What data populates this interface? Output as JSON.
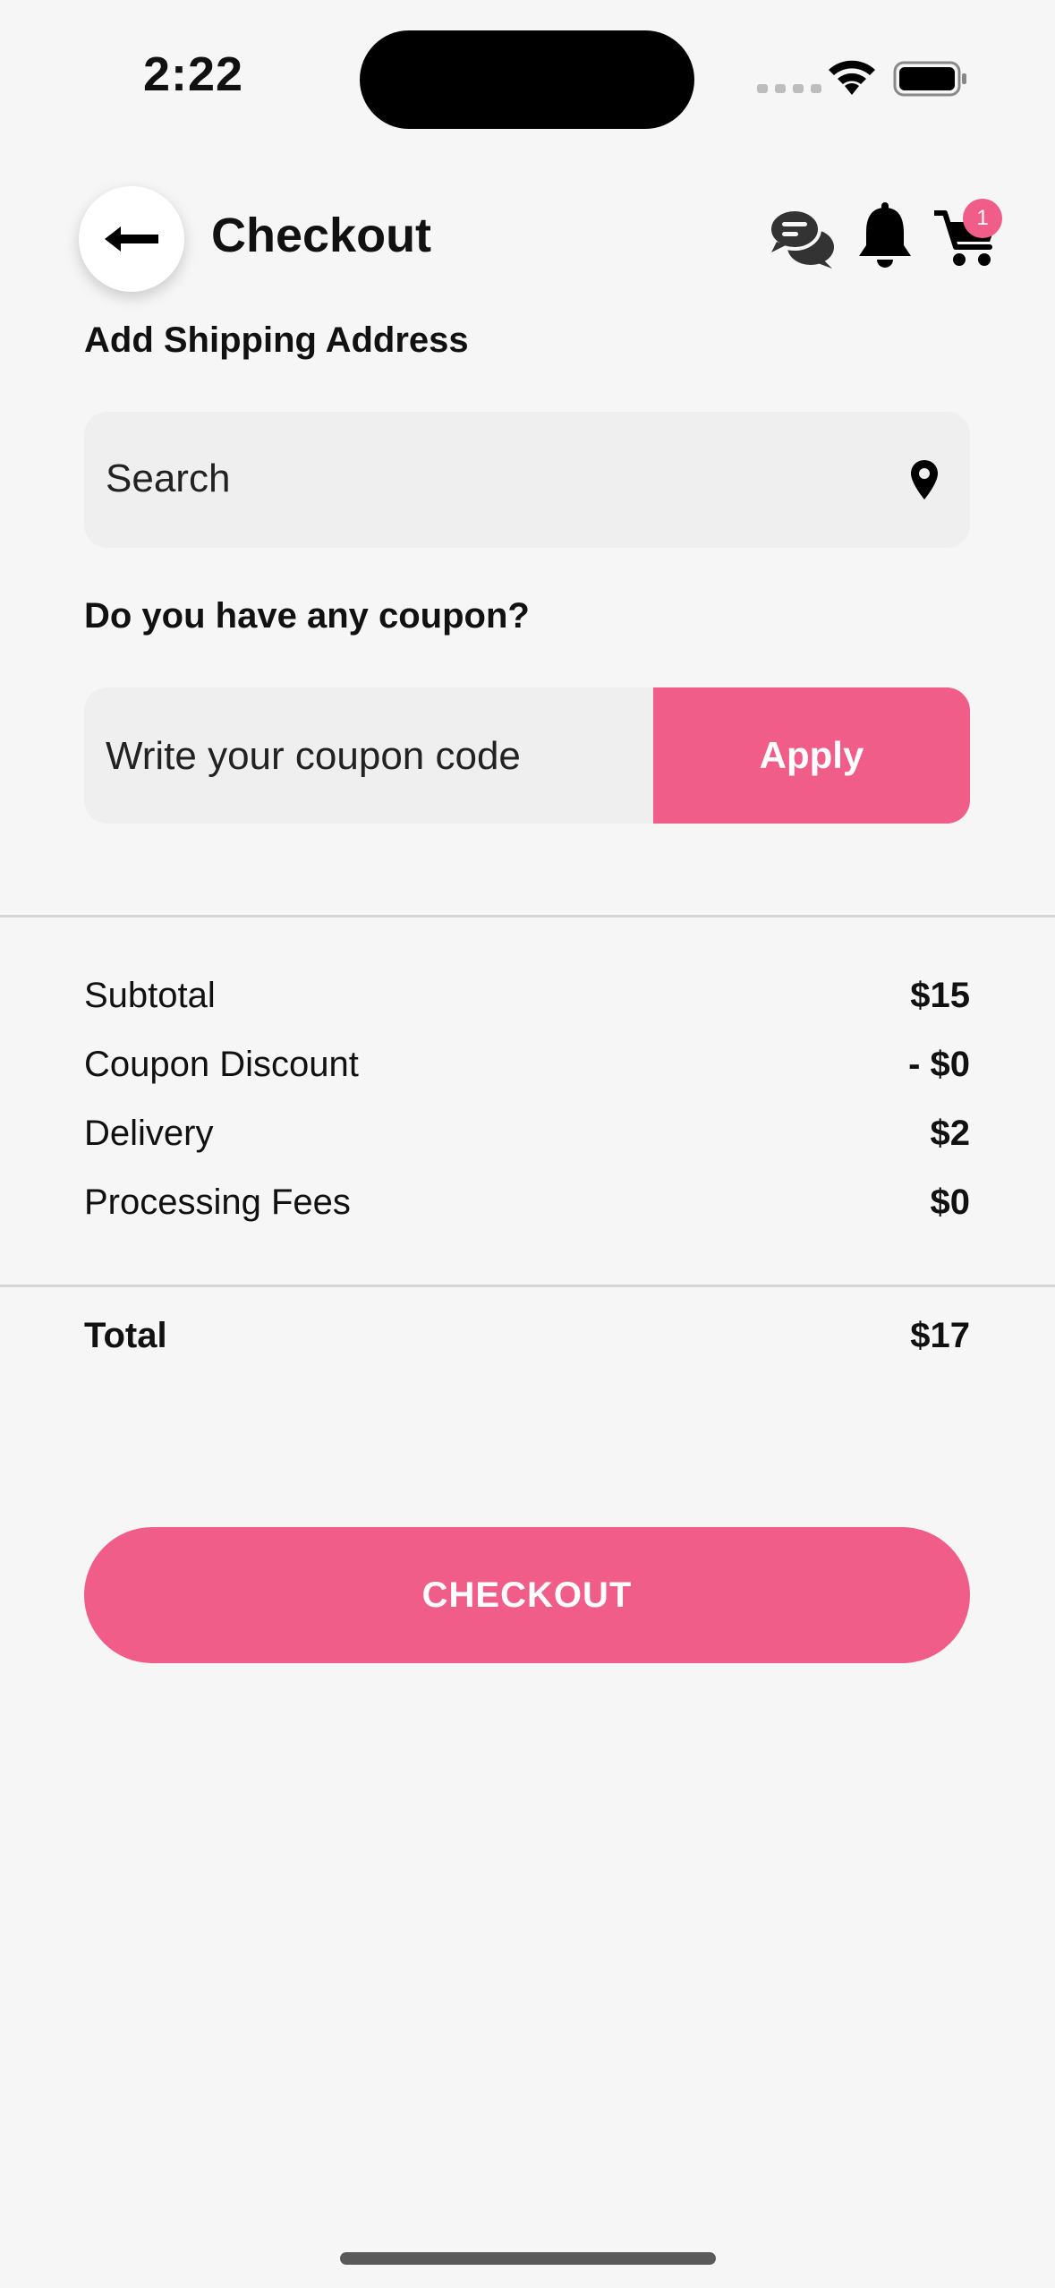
{
  "status_bar": {
    "time": "2:22"
  },
  "header": {
    "title": "Checkout",
    "cart_count": "1"
  },
  "shipping": {
    "label": "Add Shipping Address",
    "search_placeholder": "Search"
  },
  "coupon": {
    "label": "Do you have any coupon?",
    "placeholder": "Write your coupon code",
    "apply_label": "Apply"
  },
  "summary": {
    "rows": [
      {
        "label": "Subtotal",
        "value": "$15"
      },
      {
        "label": "Coupon Discount",
        "value": "- $0"
      },
      {
        "label": "Delivery",
        "value": "$2"
      },
      {
        "label": "Processing Fees",
        "value": "$0"
      }
    ],
    "total": {
      "label": "Total",
      "value": "$17"
    }
  },
  "checkout_label": "CHECKOUT",
  "colors": {
    "accent": "#f05d88",
    "background": "#f6f6f6",
    "field": "#efefef"
  },
  "icons": [
    "back-arrow-icon",
    "chat-icon",
    "bell-icon",
    "cart-icon",
    "location-pin-icon",
    "wifi-icon",
    "battery-icon"
  ]
}
